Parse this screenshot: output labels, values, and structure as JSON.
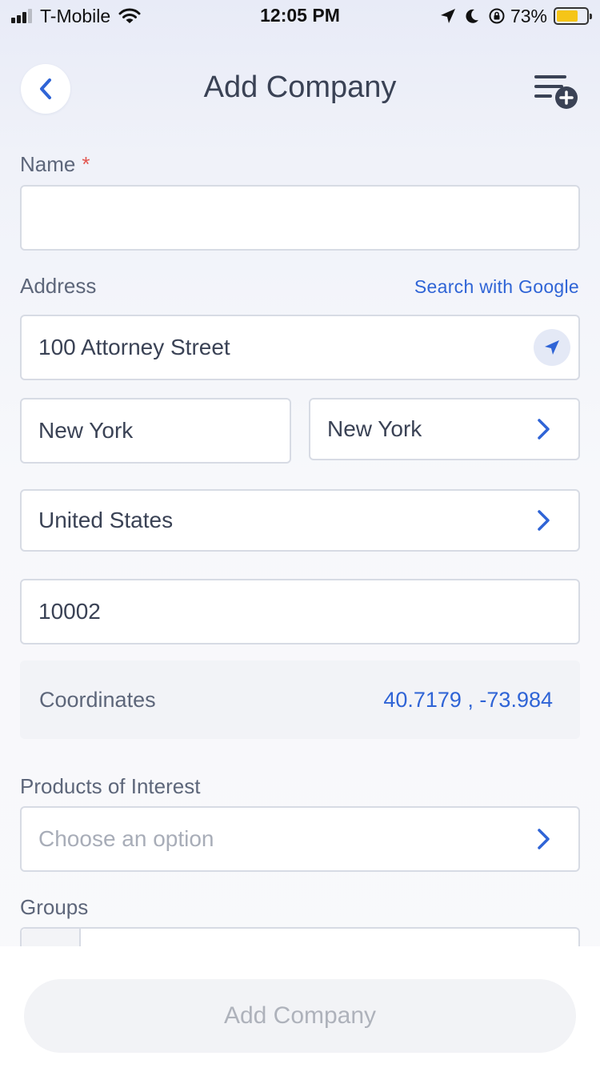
{
  "status_bar": {
    "carrier": "T-Mobile",
    "time": "12:05 PM",
    "battery_percent": "73%",
    "battery_level": 0.73,
    "signal_bars_active": 3,
    "signal_bars_total": 4
  },
  "header": {
    "title": "Add Company",
    "back_icon": "chevron-left-icon",
    "action_icon": "list-add-icon"
  },
  "form": {
    "name": {
      "label": "Name",
      "required_mark": "*",
      "value": ""
    },
    "address": {
      "label": "Address",
      "search_link": "Search with Google",
      "street": "100 Attorney Street",
      "city": "New York",
      "state": "New York",
      "country": "United States",
      "zip": "10002"
    },
    "coordinates": {
      "label": "Coordinates",
      "value": "40.7179 , -73.984"
    },
    "products": {
      "label": "Products of Interest",
      "placeholder": "Choose an option"
    },
    "groups": {
      "label": "Groups"
    }
  },
  "footer": {
    "submit_label": "Add Company"
  },
  "colors": {
    "accent": "#2f64d6",
    "required": "#e2554f",
    "battery": "#f5c518"
  }
}
